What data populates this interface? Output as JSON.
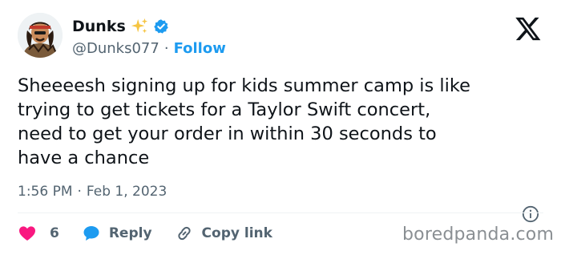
{
  "author": {
    "display_name": "Dunks",
    "handle": "@Dunks077",
    "separator": "·",
    "follow_label": "Follow",
    "avatar_icon": "avatar-cartoon-headband",
    "badges": [
      "sparkles-emoji",
      "verified-badge"
    ]
  },
  "brand": {
    "logo": "x-logo"
  },
  "tweet": {
    "lines": [
      "Sheeeesh signing up for kids summer camp is like",
      "trying to get tickets for a Taylor Swift concert,",
      "need to get your order in within 30 seconds to",
      "have a chance"
    ],
    "time": "1:56 PM",
    "date_separator": "·",
    "date": "Feb 1, 2023"
  },
  "actions": {
    "like_count": "6",
    "reply_label": "Reply",
    "copy_label": "Copy link"
  },
  "watermark": "boredpanda.com",
  "colors": {
    "accent": "#1d9bf0",
    "like": "#f91880",
    "text": "#0f1419",
    "muted": "#536471"
  }
}
